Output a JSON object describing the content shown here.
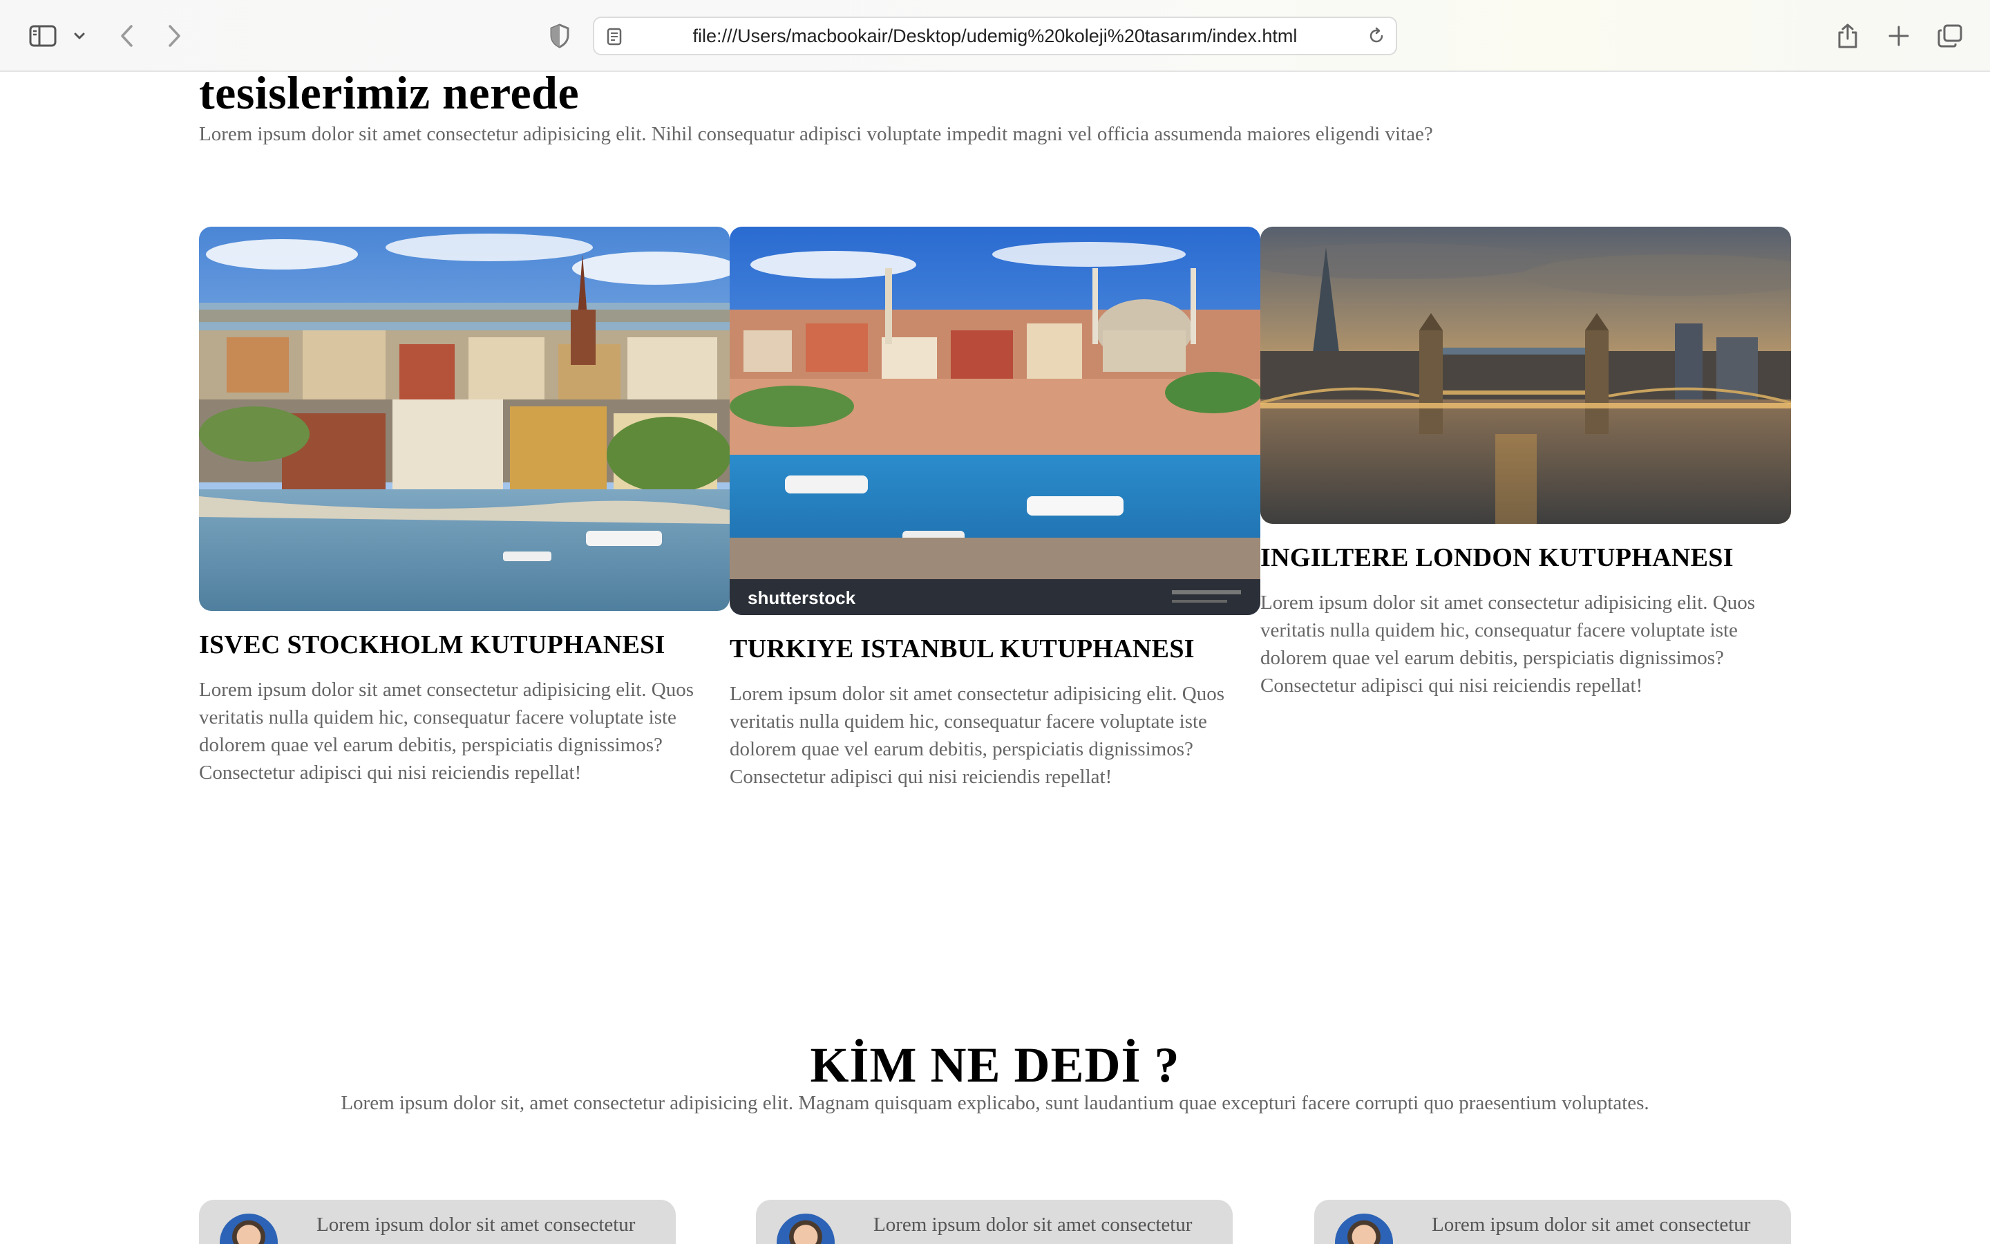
{
  "browser": {
    "url": "file:///Users/macbookair/Desktop/udemig%20koleji%20tasarım/index.html"
  },
  "facilities": {
    "title": "tesislerimiz nerede",
    "description": "Lorem ipsum dolor sit amet consectetur adipisicing elit. Nihil consequatur adipisci voluptate impedit magni vel officia assumenda maiores eligendi vitae?",
    "cards": [
      {
        "title": "ISVEC STOCKHOLM KUTUPHANESI",
        "text": "Lorem ipsum dolor sit amet consectetur adipisicing elit. Quos veritatis nulla quidem hic, consequatur facere voluptate iste dolorem quae vel earum debitis, perspiciatis dignissimos? Consectetur adipisci qui nisi reiciendis repellat!"
      },
      {
        "title": "TURKIYE ISTANBUL KUTUPHANESI",
        "text": "Lorem ipsum dolor sit amet consectetur adipisicing elit. Quos veritatis nulla quidem hic, consequatur facere voluptate iste dolorem quae vel earum debitis, perspiciatis dignissimos? Consectetur adipisci qui nisi reiciendis repellat!",
        "watermark": "shutterstock"
      },
      {
        "title": "INGILTERE LONDON KUTUPHANESI",
        "text": "Lorem ipsum dolor sit amet consectetur adipisicing elit. Quos veritatis nulla quidem hic, consequatur facere voluptate iste dolorem quae vel earum debitis, perspiciatis dignissimos? Consectetur adipisci qui nisi reiciendis repellat!"
      }
    ]
  },
  "testimonials": {
    "title": "KİM NE DEDİ ?",
    "description": "Lorem ipsum dolor sit, amet consectetur adipisicing elit. Magnam quisquam explicabo, sunt laudantium quae excepturi facere corrupti quo praesentium voluptates.",
    "items": [
      {
        "text": "Lorem ipsum dolor sit amet consectetur"
      },
      {
        "text": "Lorem ipsum dolor sit amet consectetur"
      },
      {
        "text": "Lorem ipsum dolor sit amet consectetur"
      }
    ]
  }
}
